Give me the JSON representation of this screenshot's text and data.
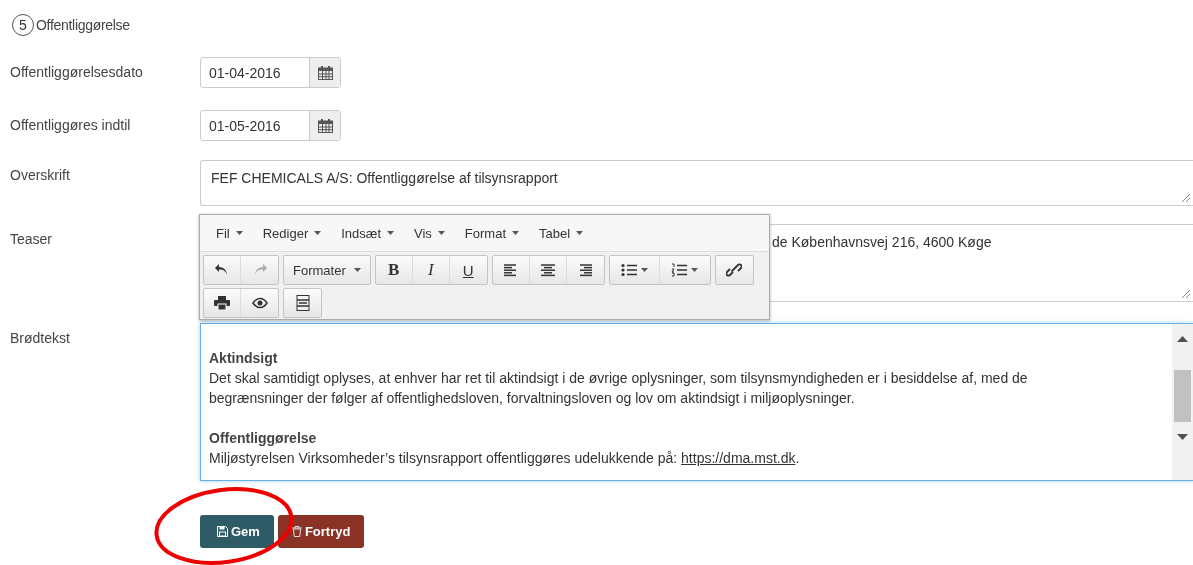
{
  "section": {
    "number": "5",
    "title": "Offentliggørelse"
  },
  "fields": [
    {
      "kind": "date",
      "label": "Offentliggørelsesdato",
      "value": "01-04-2016"
    },
    {
      "kind": "date",
      "label": "Offentliggøres indtil",
      "value": "01-05-2016"
    },
    {
      "kind": "textarea",
      "label": "Overskrift",
      "value": "FEF CHEMICALS A/S: Offentliggørelse af tilsynsrapport"
    },
    {
      "kind": "teaser",
      "label": "Teaser",
      "value": "de Københavnsvej 216, 4600 Køge"
    },
    {
      "kind": "editor",
      "label": "Brødtekst",
      "content": [
        {
          "kind": "heading",
          "text": "Aktindsigt"
        },
        {
          "kind": "paragraph",
          "text": "Det skal samtidigt oplyses, at enhver har ret til aktindsigt i de øvrige oplysninger, som tilsynsmyndigheden er i besiddelse af, med de begrænsninger der følger af offentlighedsloven, forvaltningsloven og lov om aktindsigt i miljøoplysninger."
        },
        {
          "kind": "heading",
          "text": "Offentliggørelse"
        },
        {
          "kind": "paragraph",
          "text": "Miljøstyrelsen Virksomheder’s tilsynsrapport offentliggøres udelukkende på: ",
          "link": "https://dma.mst.dk",
          "after": "."
        }
      ]
    }
  ],
  "editor_toolbar": {
    "menus": [
      "Fil",
      "Rediger",
      "Indsæt",
      "Vis",
      "Format",
      "Tabel"
    ],
    "format_dropdown": "Formater",
    "text_styles": [
      "B",
      "I",
      "U"
    ]
  },
  "buttons": [
    {
      "kind": "save",
      "label": "Gem"
    },
    {
      "kind": "cancel",
      "label": "Fortryd"
    }
  ]
}
